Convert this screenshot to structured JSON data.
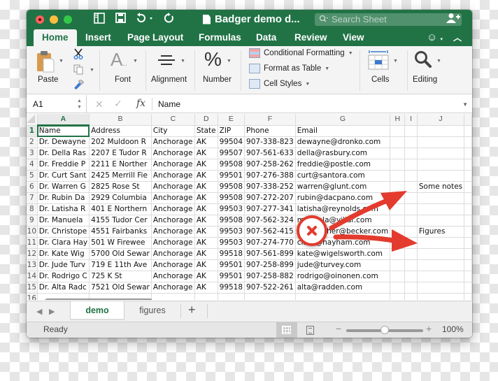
{
  "window": {
    "doc_title": "Badger demo d...",
    "search_placeholder": "Search Sheet"
  },
  "ribbon_tabs": [
    "Home",
    "Insert",
    "Page Layout",
    "Formulas",
    "Data",
    "Review",
    "View"
  ],
  "active_ribbon_tab": "Home",
  "ribbon": {
    "paste": "Paste",
    "font": "Font",
    "alignment": "Alignment",
    "number": "Number",
    "conditional_formatting": "Conditional Formatting",
    "format_as_table": "Format as Table",
    "cell_styles": "Cell Styles",
    "cells": "Cells",
    "editing": "Editing"
  },
  "formula_bar": {
    "name_box": "A1",
    "fx": "fx",
    "value": "Name"
  },
  "grid": {
    "columns": [
      "A",
      "B",
      "C",
      "D",
      "E",
      "F",
      "G",
      "H",
      "I",
      "J"
    ],
    "active_column": "A",
    "rows": [
      {
        "n": "1",
        "cells": [
          "Name",
          "Address",
          "City",
          "State",
          "ZIP",
          "Phone",
          "Email",
          "",
          "",
          ""
        ]
      },
      {
        "n": "2",
        "cells": [
          "Dr. Dewayne",
          "202 Muldoon R",
          "Anchorage",
          "AK",
          "99504",
          "907-338-823",
          "dewayne@dronko.com",
          "",
          "",
          ""
        ]
      },
      {
        "n": "3",
        "cells": [
          "Dr. Della Ras",
          "2207 E Tudor R",
          "Anchorage",
          "AK",
          "99507",
          "907-561-633",
          "della@rasbury.com",
          "",
          "",
          ""
        ]
      },
      {
        "n": "4",
        "cells": [
          "Dr. Freddie P",
          "2211 E Norther",
          "Anchorage",
          "AK",
          "99508",
          "907-258-262",
          "freddie@postle.com",
          "",
          "",
          ""
        ]
      },
      {
        "n": "5",
        "cells": [
          "Dr. Curt Sant",
          "2425 Merrill Fie",
          "Anchorage",
          "AK",
          "99501",
          "907-276-388",
          "curt@santora.com",
          "",
          "",
          ""
        ]
      },
      {
        "n": "6",
        "cells": [
          "Dr. Warren G",
          "2825 Rose St",
          "Anchorage",
          "AK",
          "99508",
          "907-338-252",
          "warren@glunt.com",
          "",
          "",
          "Some notes"
        ]
      },
      {
        "n": "7",
        "cells": [
          "Dr. Rubin Da",
          "2929 Columbia",
          "Anchorage",
          "AK",
          "99508",
          "907-272-207",
          "rubin@dacpano.com",
          "",
          "",
          ""
        ]
      },
      {
        "n": "8",
        "cells": [
          "Dr. Latisha R",
          "401 E Northern",
          "Anchorage",
          "AK",
          "99503",
          "907-277-341",
          "latisha@reynolds.com",
          "",
          "",
          ""
        ]
      },
      {
        "n": "9",
        "cells": [
          "Dr. Manuela",
          "4155 Tudor Cer",
          "Anchorage",
          "AK",
          "99508",
          "907-562-324",
          "manuela@villar.com",
          "",
          "",
          ""
        ]
      },
      {
        "n": "10",
        "cells": [
          "Dr. Christope",
          "4551 Fairbanks",
          "Anchorage",
          "AK",
          "99503",
          "907-562-415",
          "christopher@becker.com",
          "",
          "",
          "Figures"
        ]
      },
      {
        "n": "11",
        "cells": [
          "Dr. Clara Hay",
          "501 W Firewee",
          "Anchorage",
          "AK",
          "99503",
          "907-274-770",
          "clara@hayham.com",
          "",
          "",
          ""
        ]
      },
      {
        "n": "12",
        "cells": [
          "Dr. Kate Wig",
          "5700 Old Sewar",
          "Anchorage",
          "AK",
          "99518",
          "907-561-899",
          "kate@wigelsworth.com",
          "",
          "",
          ""
        ]
      },
      {
        "n": "13",
        "cells": [
          "Dr. Jude Turv",
          "719 E 11th Ave",
          "Anchorage",
          "AK",
          "99501",
          "907-258-899",
          "jude@turvey.com",
          "",
          "",
          ""
        ]
      },
      {
        "n": "14",
        "cells": [
          "Dr. Rodrigo C",
          "725 K St",
          "Anchorage",
          "AK",
          "99501",
          "907-258-882",
          "rodrigo@oinonen.com",
          "",
          "",
          ""
        ]
      },
      {
        "n": "15",
        "cells": [
          "Dr. Alta Radc",
          "7521 Old Sewar",
          "Anchorage",
          "AK",
          "99518",
          "907-522-261",
          "alta@radden.com",
          "",
          "",
          ""
        ]
      },
      {
        "n": "16",
        "cells": [
          "",
          "",
          "",
          "",
          "",
          "",
          "",
          "",
          "",
          ""
        ]
      }
    ]
  },
  "sheets": [
    "demo",
    "figures"
  ],
  "active_sheet": "demo",
  "add_sheet": "+",
  "status": {
    "text": "Ready",
    "zoom_percent": "100%",
    "zoom_fraction": 0.5
  },
  "annotation": {
    "color": "#e33b2e",
    "badge_icon": "error-x-icon"
  }
}
